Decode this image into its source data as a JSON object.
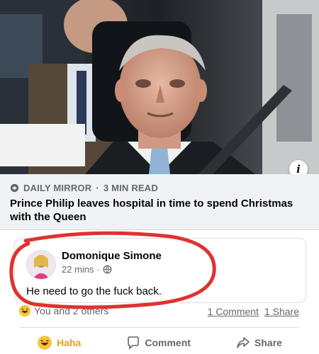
{
  "link_preview": {
    "source": "DAILY MIRROR",
    "separator": "·",
    "read_time": "3 MIN READ",
    "headline": "Prince Philip leaves hospital in time to spend Christmas with the Queen",
    "info_label": "i"
  },
  "comment": {
    "author": "Domonique Simone",
    "time": "22 mins",
    "separator": "·",
    "text": "He need to go the fuck back."
  },
  "stats": {
    "reactions_text": "You and 2 others",
    "comments": "1 Comment",
    "shares": "1 Share"
  },
  "actions": {
    "haha": "Haha",
    "comment": "Comment",
    "share": "Share"
  },
  "colors": {
    "haha": "#e8a410",
    "annotation_circle": "#e0322f",
    "muted_text": "#65676b"
  }
}
